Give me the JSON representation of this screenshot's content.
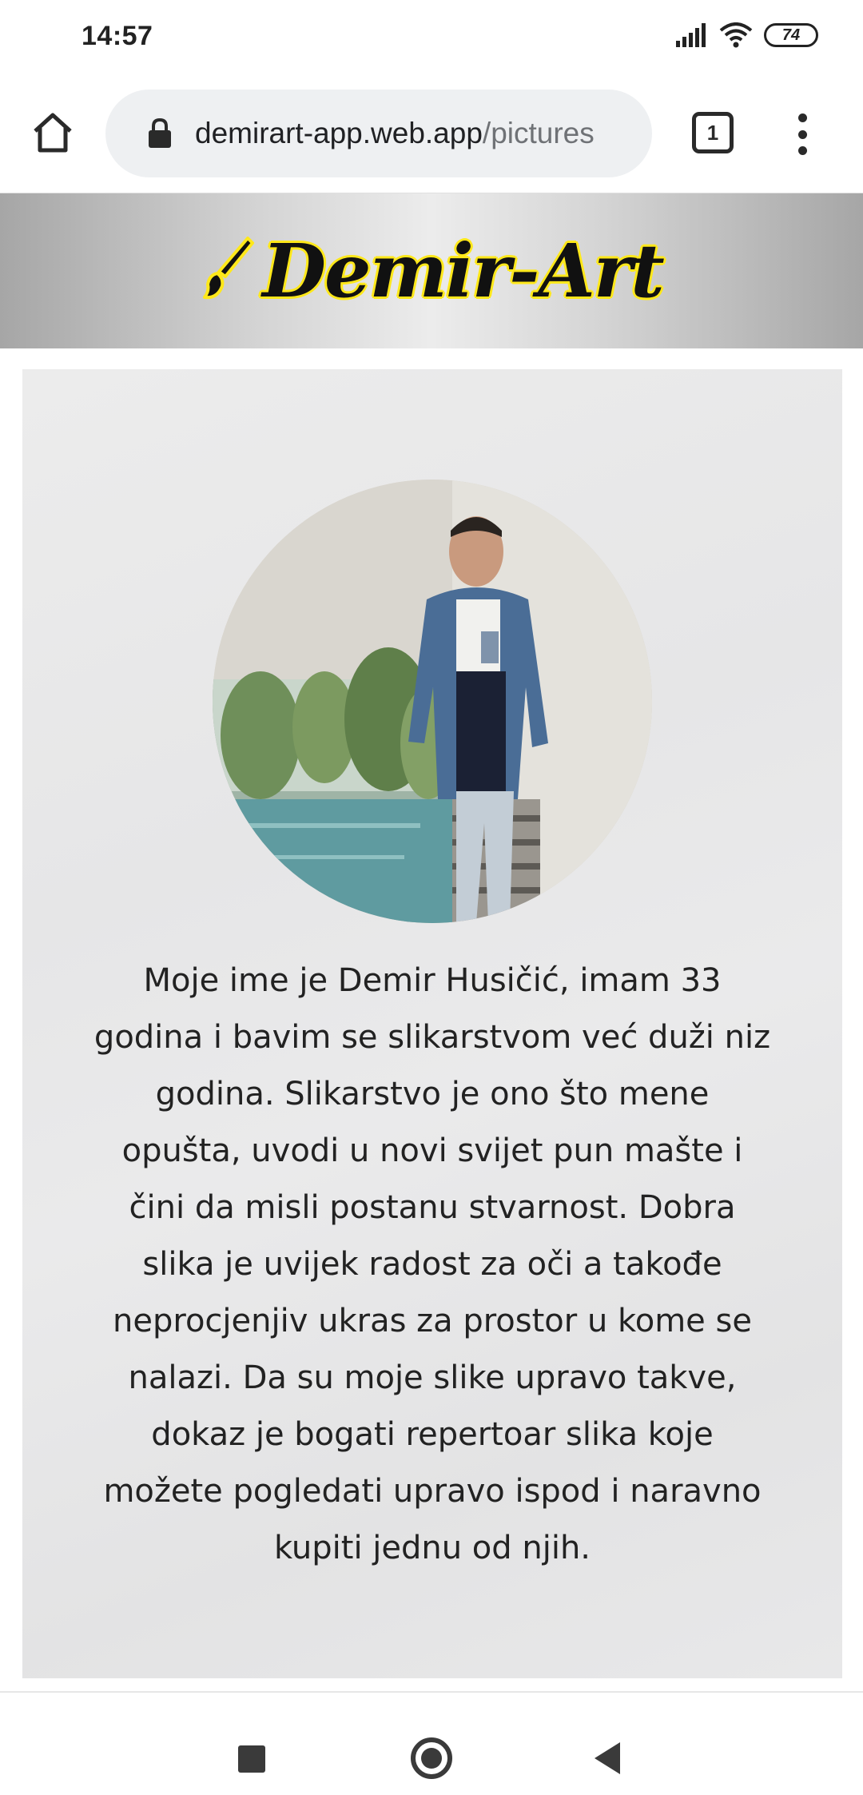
{
  "status_bar": {
    "time": "14:57",
    "battery": "74",
    "icons": [
      "signal-icon",
      "wifi-icon",
      "battery-icon"
    ]
  },
  "browser": {
    "url_host": "demirart-app.web.app",
    "url_path": "/pictures",
    "tab_count": "1",
    "icons": [
      "home-icon",
      "lock-icon",
      "tabs-icon",
      "more-menu-icon"
    ]
  },
  "site": {
    "logo_text": "Demir-Art",
    "logo_colors": {
      "text": "#111111",
      "outline": "#ffe81a"
    },
    "about_text": "Moje ime je Demir Husičić, imam 33 godina i bavim se slikarstvom već duži niz godina. Slikarstvo je ono što mene opušta, uvodi u novi svijet pun mašte i čini da misli postanu stvarnost. Dobra slika je uvijek radost za oči a takođe neprocjenjiv ukras za prostor u kome se nalazi. Da su moje slike upravo takve, dokaz je bogati repertoar slika koje možete pogledati upravo ispod i naravno kupiti jednu od njih."
  },
  "nav_bar": {
    "icons": [
      "recents-icon",
      "home-icon",
      "back-icon"
    ]
  }
}
